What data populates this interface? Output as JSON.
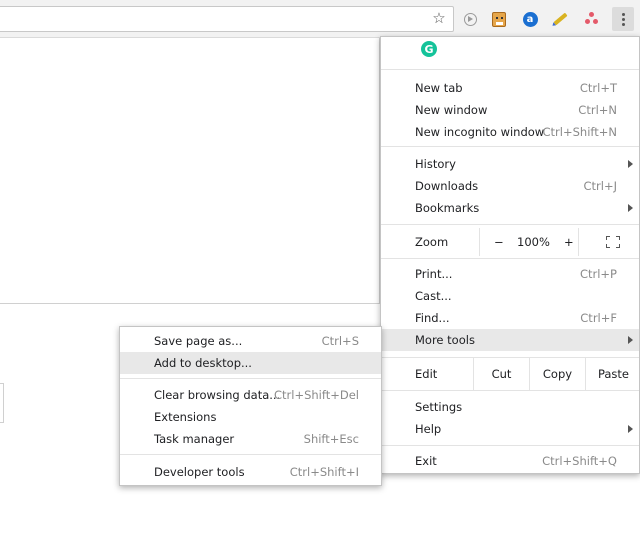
{
  "toolbar": {
    "star_icon": "star-icon",
    "extensions": [
      "play-extension-icon",
      "face-extension-icon",
      "a-extension-icon",
      "highlighter-extension-icon",
      "dots-extension-icon"
    ],
    "menu_icon": "three-dot-menu-icon"
  },
  "main_menu": {
    "grammarly_letter": "G",
    "new_tab": {
      "label": "New tab",
      "shortcut": "Ctrl+T"
    },
    "new_window": {
      "label": "New window",
      "shortcut": "Ctrl+N"
    },
    "new_incognito": {
      "label": "New incognito window",
      "shortcut": "Ctrl+Shift+N"
    },
    "history": {
      "label": "History"
    },
    "downloads": {
      "label": "Downloads",
      "shortcut": "Ctrl+J"
    },
    "bookmarks": {
      "label": "Bookmarks"
    },
    "zoom": {
      "label": "Zoom",
      "minus": "−",
      "value": "100%",
      "plus": "+"
    },
    "print": {
      "label": "Print...",
      "shortcut": "Ctrl+P"
    },
    "cast": {
      "label": "Cast..."
    },
    "find": {
      "label": "Find...",
      "shortcut": "Ctrl+F"
    },
    "more_tools": {
      "label": "More tools"
    },
    "edit": {
      "label": "Edit",
      "cut": "Cut",
      "copy": "Copy",
      "paste": "Paste"
    },
    "settings": {
      "label": "Settings"
    },
    "help": {
      "label": "Help"
    },
    "exit": {
      "label": "Exit",
      "shortcut": "Ctrl+Shift+Q"
    }
  },
  "sub_menu": {
    "save_page": {
      "label": "Save page as...",
      "shortcut": "Ctrl+S"
    },
    "add_desktop": {
      "label": "Add to desktop..."
    },
    "clear_data": {
      "label": "Clear browsing data...",
      "shortcut": "Ctrl+Shift+Del"
    },
    "extensions": {
      "label": "Extensions"
    },
    "task_manager": {
      "label": "Task manager",
      "shortcut": "Shift+Esc"
    },
    "dev_tools": {
      "label": "Developer tools",
      "shortcut": "Ctrl+Shift+I"
    }
  }
}
